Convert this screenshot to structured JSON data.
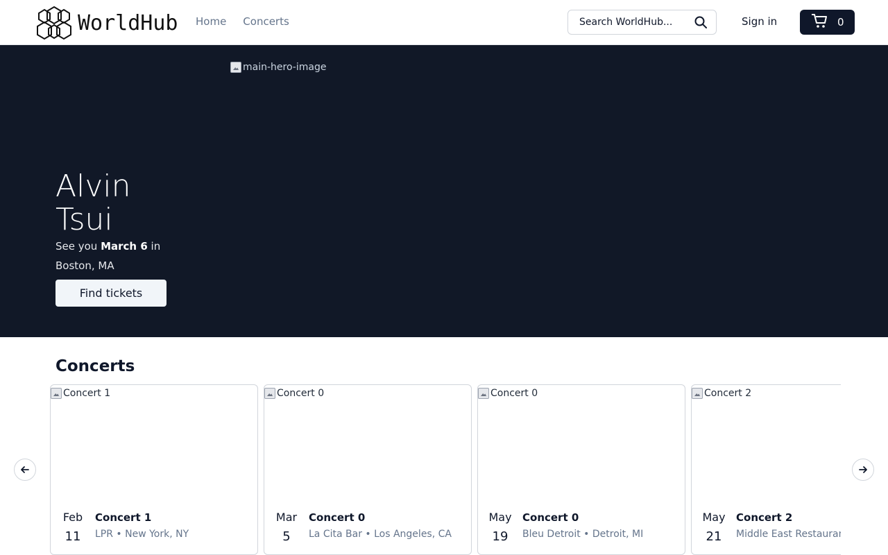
{
  "header": {
    "brand": "WorldHub",
    "nav": [
      {
        "label": "Home"
      },
      {
        "label": "Concerts"
      }
    ],
    "search_placeholder": "Search WorldHub...",
    "signin_label": "Sign in",
    "cart_count": "0"
  },
  "hero": {
    "image_alt": "main-hero-image",
    "title": "Alvin Tsui",
    "sub_prefix": "See you ",
    "sub_date": "March 6",
    "sub_mid": " in",
    "sub_location": "Boston, MA",
    "cta_label": "Find tickets"
  },
  "concerts": {
    "title": "Concerts",
    "items": [
      {
        "image_alt": "Concert 1",
        "month": "Feb",
        "day": "11",
        "name": "Concert 1",
        "venue": "LPR • New York, NY"
      },
      {
        "image_alt": "Concert 0",
        "month": "Mar",
        "day": "5",
        "name": "Concert 0",
        "venue": "La Cita Bar • Los Angeles, CA"
      },
      {
        "image_alt": "Concert 0",
        "month": "May",
        "day": "19",
        "name": "Concert 0",
        "venue": "Bleu Detroit • Detroit, MI"
      },
      {
        "image_alt": "Concert 2",
        "month": "May",
        "day": "21",
        "name": "Concert 2",
        "venue": "Middle East Restaurant • Cambridge, MA"
      }
    ]
  },
  "icons": {
    "search": "search-icon",
    "cart": "cart-icon",
    "prev": "arrow-left-icon",
    "next": "arrow-right-icon"
  },
  "colors": {
    "hero_bg": "#111827",
    "primary": "#0f172a",
    "muted": "#64748b"
  }
}
